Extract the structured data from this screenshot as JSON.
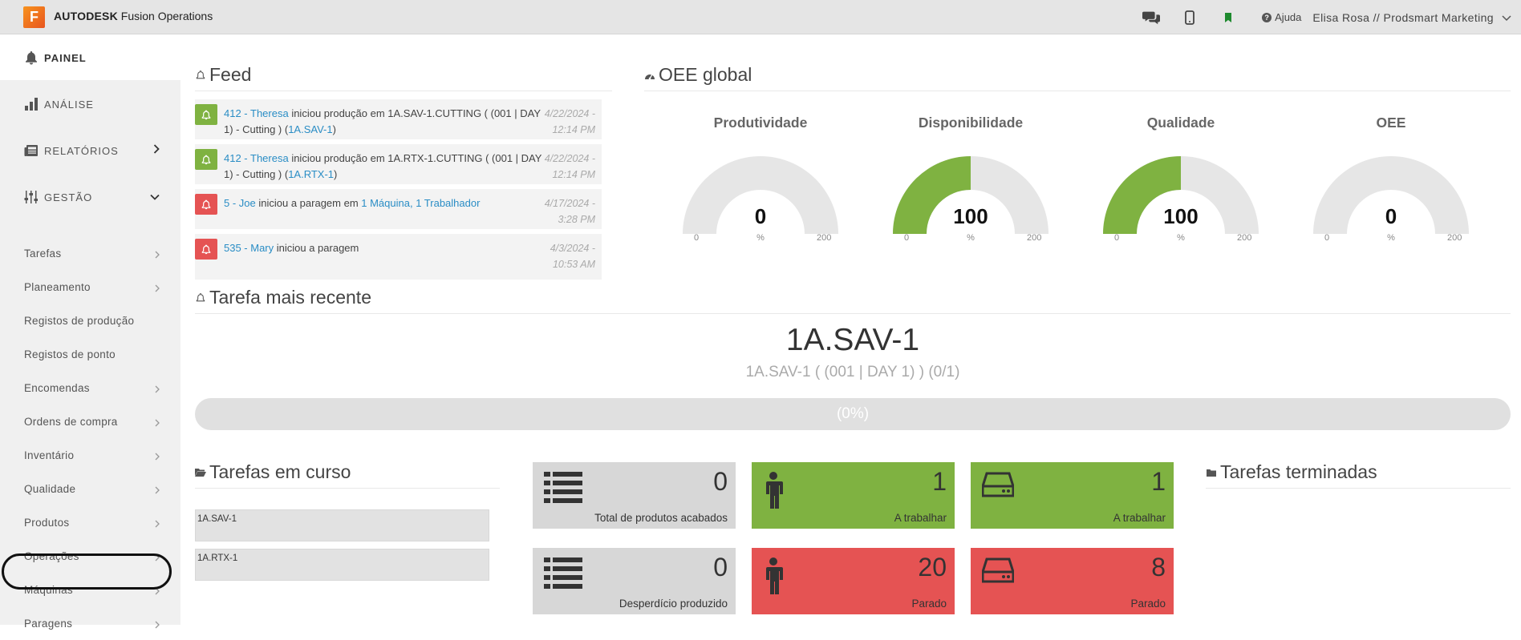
{
  "header": {
    "logo_letter": "F",
    "brand_strong": "AUTODESK",
    "brand_rest": "Fusion Operations",
    "help_label": "Ajuda",
    "user_label": "Elisa Rosa // Prodsmart Marketing"
  },
  "sidebar": {
    "painel": "PAINEL",
    "analise": "ANÁLISE",
    "relatorios": "RELATÓRIOS",
    "gestao": "GESTÃO",
    "items": [
      {
        "label": "Tarefas",
        "chevron": true
      },
      {
        "label": "Planeamento",
        "chevron": true
      },
      {
        "label": "Registos de produção",
        "chevron": false
      },
      {
        "label": "Registos de ponto",
        "chevron": false
      },
      {
        "label": "Encomendas",
        "chevron": true
      },
      {
        "label": "Ordens de compra",
        "chevron": true
      },
      {
        "label": "Inventário",
        "chevron": true
      },
      {
        "label": "Qualidade",
        "chevron": true
      },
      {
        "label": "Produtos",
        "chevron": true
      },
      {
        "label": "Operações",
        "chevron": true
      },
      {
        "label": "Máquinas",
        "chevron": true
      },
      {
        "label": "Paragens",
        "chevron": true
      }
    ]
  },
  "feed": {
    "title": "Feed",
    "items": [
      {
        "status": "green",
        "who": "412 - Theresa",
        "text1": " iniciou produção em 1A.SAV-1.CUTTING ( (001 | DAY 1) - Cutting ) (",
        "link": "1A.SAV-1",
        "text2": ")",
        "date": "4/22/2024 - 12:14 PM"
      },
      {
        "status": "green",
        "who": "412 - Theresa",
        "text1": " iniciou produção em 1A.RTX-1.CUTTING ( (001 | DAY 1) - Cutting ) (",
        "link": "1A.RTX-1",
        "text2": ")",
        "date": "4/22/2024 - 12:14 PM"
      },
      {
        "status": "red",
        "who": "5 - Joe",
        "text1": " iniciou a paragem em ",
        "link": "1 Máquina, 1 Trabalhador",
        "text2": "",
        "date": "4/17/2024 - 3:28 PM"
      },
      {
        "status": "red",
        "who": "535 - Mary",
        "text1": " iniciou a paragem",
        "link": "",
        "text2": "",
        "date": "4/3/2024 - 10:53 AM"
      }
    ]
  },
  "oee": {
    "title": "OEE global",
    "min": "0",
    "max": "200",
    "unit": "%",
    "gauges": [
      {
        "title": "Produtividade",
        "value": "0",
        "level": 0
      },
      {
        "title": "Disponibilidade",
        "value": "100",
        "level": 0.5
      },
      {
        "title": "Qualidade",
        "value": "100",
        "level": 0.5
      },
      {
        "title": "OEE",
        "value": "0",
        "level": 0
      }
    ],
    "fill_color": "#7fb241",
    "track_color": "#e6e6e6"
  },
  "recent": {
    "title": "Tarefa mais recente",
    "name": "1A.SAV-1",
    "subtitle": "1A.SAV-1 ( (001 | DAY 1) ) (0/1)",
    "progress_label": "(0%)",
    "progress": 0
  },
  "in_progress": {
    "title": "Tarefas em curso",
    "tasks": [
      "1A.SAV-1",
      "1A.RTX-1"
    ]
  },
  "tiles": [
    {
      "color": "grey",
      "icon": "list-icon",
      "value": "0",
      "label": "Total de produtos acabados"
    },
    {
      "color": "green",
      "icon": "worker-icon",
      "value": "1",
      "label": "A trabalhar"
    },
    {
      "color": "green",
      "icon": "machine-icon",
      "value": "1",
      "label": "A trabalhar"
    },
    {
      "color": "grey",
      "icon": "list-icon",
      "value": "0",
      "label": "Desperdício produzido"
    },
    {
      "color": "red",
      "icon": "worker-icon",
      "value": "20",
      "label": "Parado"
    },
    {
      "color": "red",
      "icon": "machine-icon",
      "value": "8",
      "label": "Parado"
    }
  ],
  "finished": {
    "title": "Tarefas terminadas"
  },
  "colors": {
    "green": "#7fb241",
    "red": "#e55353",
    "link": "#2a8dc5"
  }
}
